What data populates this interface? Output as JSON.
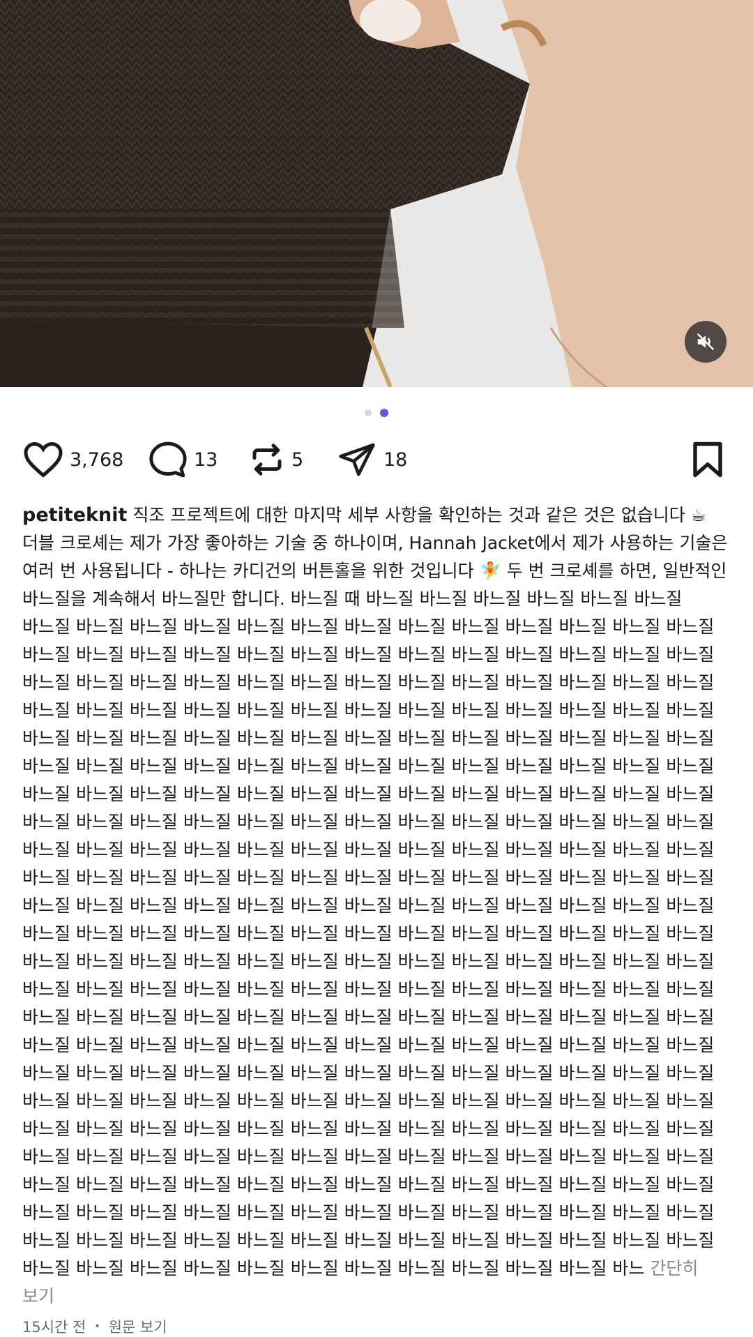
{
  "post": {
    "media": {
      "description_icons": {
        "mute": "speaker-muted-icon"
      },
      "carousel": {
        "count": 2,
        "active_index": 1
      }
    },
    "actions": {
      "likes": "3,768",
      "comments": "13",
      "reposts": "5",
      "shares": "18"
    },
    "caption": {
      "username": "petiteknit",
      "text": "직조 프로젝트에 대한 마지막 세부 사항을 확인하는 것과 같은 것은 없습니다 ☕ 더블 크로셰는 제가 가장 좋아하는 기술 중 하나이며, Hannah Jacket에서 제가 사용하는 기술은 여러 번 사용됩니다 - 하나는 카디건의 버튼홀을 위한 것입니다 🧚 두 번 크로셰를 하면, 일반적인 바느질을 계속해서 바느질만 합니다. 바느질 때 바느질 바느질 바느질 바느질 바느질 바느질 바느질 바느질 바느질 바느질 바느질 바느질 바느질 바느질 바느질 바느질 바느질 바느질 바느질 바느질 바느질 바느질 바느질 바느질 바느질 바느질 바느질 바느질 바느질 바느질 바느질 바느질 바느질 바느질 바느질 바느질 바느질 바느질 바느질 바느질 바느질 바느질 바느질 바느질 바느질 바느질 바느질 바느질 바느질 바느질 바느질 바느질 바느질 바느질 바느질 바느질 바느질 바느질 바느질 바느질 바느질 바느질 바느질 바느질 바느질 바느질 바느질 바느질 바느질 바느질 바느질 바느질 바느질 바느질 바느질 바느질 바느질 바느질 바느질 바느질 바느질 바느질 바느질 바느질 바느질 바느질 바느질 바느질 바느질 바느질 바느질 바느질 바느질 바느질 바느질 바느질 바느질 바느질 바느질 바느질 바느질 바느질 바느질 바느질 바느질 바느질 바느질 바느질 바느질 바느질 바느질 바느질 바느질 바느질 바느질 바느질 바느질 바느질 바느질 바느질 바느질 바느질 바느질 바느질 바느질 바느질 바느질 바느질 바느질 바느질 바느질 바느질 바느질 바느질 바느질 바느질 바느질 바느질 바느질 바느질 바느질 바느질 바느질 바느질 바느질 바느질 바느질 바느질 바느질 바느질 바느질 바느질 바느질 바느질 바느질 바느질 바느질 바느질 바느질 바느질 바느질 바느질 바느질 바느질 바느질 바느질 바느질 바느질 바느질 바느질 바느질 바느질 바느질 바느질 바느질 바느질 바느질 바느질 바느질 바느질 바느질 바느질 바느질 바느질 바느질 바느질 바느질 바느질 바느질 바느질 바느질 바느질 바느질 바느질 바느질 바느질 바느질 바느질 바느질 바느질 바느질 바느질 바느질 바느질 바느질 바느질 바느질 바느질 바느질 바느질 바느질 바느질 바느질 바느질 바느질 바느질 바느질 바느질 바느질 바느질 바느질 바느질 바느질 바느질 바느질 바느질 바느질 바느질 바느질 바느질 바느질 바느질 바느질 바느질 바느질 바느질 바느질 바느질 바느질 바느질 바느질 바느질 바느질 바느질 바느질 바느질 바느질 바느질 바느질 바느질 바느질 바느질 바느질 바느질 바느질 바느질 바느질 바느질 바느질 바느질 바느질 바느질 바느질 바느질 바느질 바느질 바느질 바느질 바느질 바느질 바느질 바느질 바느질 바느질 바느질 바느질 바느질 바느질 바느질 바느질 바느질 바느질 바느질 바느질 바느질 바느질 바느질 바느질 바느질 바느질 바느질 바느질 바느질 바느질 바느질 바느질 바느질 바느질 바느질 바느질 바느질 바느질 바느질 바느질 바느질 바느질 바느질 바느질 바느질 바느질 바느질 바느질 바느질 바느질 바느질 바느질 바느",
      "collapse_label": "간단히 보기"
    },
    "meta": {
      "timestamp": "15시간 전",
      "separator": "•",
      "view_original": "원문 보기"
    }
  },
  "colors": {
    "accent": "#5b5bd6",
    "muted": "#8a8a8a"
  }
}
